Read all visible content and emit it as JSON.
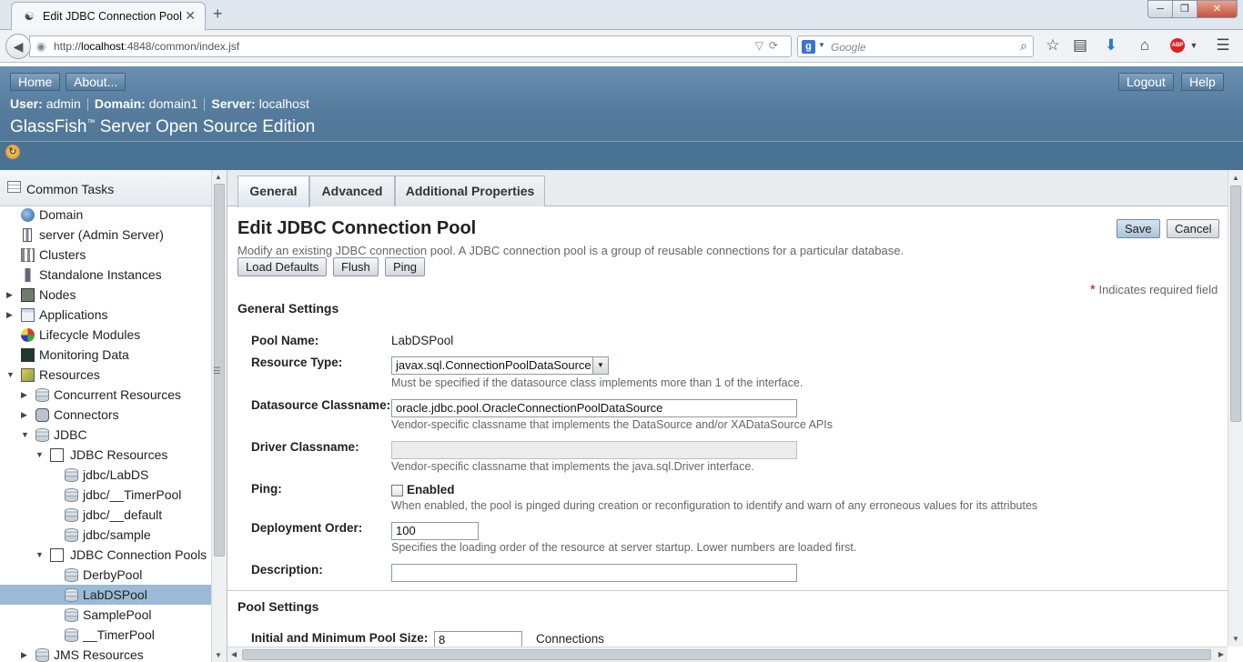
{
  "browser": {
    "tab_title": "Edit JDBC Connection Pool",
    "url_prefix": "http://",
    "url_host": "localhost",
    "url_rest": ":4848/common/index.jsf",
    "search_placeholder": "Google",
    "search_engine_letter": "g",
    "abp_label": "ABP"
  },
  "masthead": {
    "home_label": "Home",
    "about_label": "About...",
    "logout_label": "Logout",
    "help_label": "Help",
    "user_key": "User:",
    "user_value": "admin",
    "domain_key": "Domain:",
    "domain_value": "domain1",
    "server_key": "Server:",
    "server_value": "localhost",
    "product_name": "GlassFish",
    "product_tm": "™",
    "product_suffix": " Server Open Source Edition"
  },
  "tree": {
    "header": "Common Tasks",
    "items": [
      {
        "label": "Domain"
      },
      {
        "label": "server (Admin Server)"
      },
      {
        "label": "Clusters"
      },
      {
        "label": "Standalone Instances"
      },
      {
        "label": "Nodes"
      },
      {
        "label": "Applications"
      },
      {
        "label": "Lifecycle Modules"
      },
      {
        "label": "Monitoring Data"
      },
      {
        "label": "Resources"
      },
      {
        "label": "Concurrent Resources"
      },
      {
        "label": "Connectors"
      },
      {
        "label": "JDBC"
      },
      {
        "label": "JDBC Resources"
      },
      {
        "label": "jdbc/LabDS"
      },
      {
        "label": "jdbc/__TimerPool"
      },
      {
        "label": "jdbc/__default"
      },
      {
        "label": "jdbc/sample"
      },
      {
        "label": "JDBC Connection Pools"
      },
      {
        "label": "DerbyPool"
      },
      {
        "label": "LabDSPool"
      },
      {
        "label": "SamplePool"
      },
      {
        "label": "__TimerPool"
      },
      {
        "label": "JMS Resources"
      }
    ],
    "selected": "LabDSPool"
  },
  "tabs": [
    {
      "label": "General"
    },
    {
      "label": "Advanced"
    },
    {
      "label": "Additional Properties"
    }
  ],
  "page": {
    "title": "Edit JDBC Connection Pool",
    "help": "Modify an existing JDBC connection pool. A JDBC connection pool is a group of reusable connections for a particular database.",
    "save_label": "Save",
    "cancel_label": "Cancel",
    "load_defaults_label": "Load Defaults",
    "flush_label": "Flush",
    "ping_label": "Ping",
    "required_star": "*",
    "required_note": " Indicates required field"
  },
  "general_settings": {
    "heading": "General Settings",
    "pool_name_label": "Pool Name:",
    "pool_name_value": "LabDSPool",
    "resource_type_label": "Resource Type:",
    "resource_type_value": "javax.sql.ConnectionPoolDataSource",
    "resource_type_help": "Must be specified if the datasource class implements more than 1 of the interface.",
    "ds_classname_label": "Datasource Classname:",
    "ds_classname_value": "oracle.jdbc.pool.OracleConnectionPoolDataSource",
    "ds_classname_help": "Vendor-specific classname that implements the DataSource and/or XADataSource APIs",
    "driver_classname_label": "Driver Classname:",
    "driver_classname_value": "",
    "driver_classname_help": "Vendor-specific classname that implements the java.sql.Driver interface.",
    "ping_label": "Ping:",
    "ping_checkbox_label": "Enabled",
    "ping_checked": false,
    "ping_help": "When enabled, the pool is pinged during creation or reconfiguration to identify and warn of any erroneous values for its attributes",
    "deployment_order_label": "Deployment Order:",
    "deployment_order_value": "100",
    "deployment_order_help": "Specifies the loading order of the resource at server startup. Lower numbers are loaded first.",
    "description_label": "Description:",
    "description_value": ""
  },
  "pool_settings": {
    "heading": "Pool Settings",
    "initial_min_label": "Initial and Minimum Pool Size:",
    "initial_min_value": "8",
    "initial_min_unit": "Connections"
  },
  "colors": {
    "masthead": "#557b9c",
    "selected_tree_item": "#9bbad6",
    "required_star": "#cc0000"
  },
  "icons": {
    "favicon": "glassfish-icon",
    "back": "back-arrow-icon",
    "refresh": "refresh-icon",
    "bookmark": "star-icon",
    "reading_list": "clipboard-icon",
    "download": "download-arrow-icon",
    "home": "home-icon",
    "menu": "hamburger-menu-icon"
  }
}
